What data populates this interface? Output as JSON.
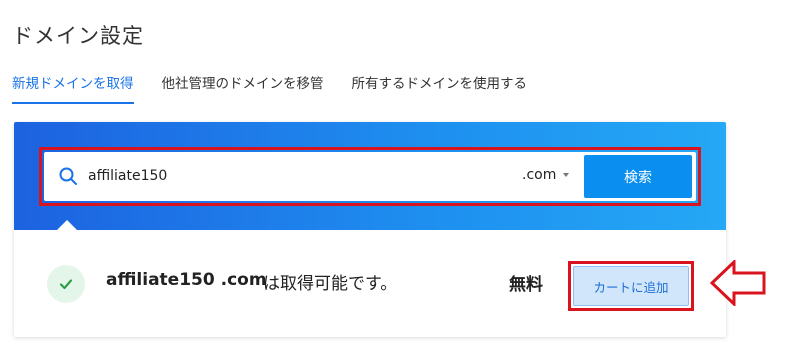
{
  "page": {
    "title": "ドメイン設定"
  },
  "tabs": [
    {
      "label": "新規ドメインを取得",
      "active": true
    },
    {
      "label": "他社管理のドメインを移管",
      "active": false
    },
    {
      "label": "所有するドメインを使用する",
      "active": false
    }
  ],
  "search": {
    "value": "affiliate150",
    "tld": ".com",
    "button_label": "検索",
    "icon": "search-icon"
  },
  "result": {
    "domain": "affiliate150 .com",
    "message": "は取得可能です。",
    "price": "無料",
    "cart_button_label": "カートに追加",
    "status_icon": "check-icon"
  },
  "colors": {
    "accent": "#1a73e8",
    "band_start": "#1d62e0",
    "band_end": "#25a8f5",
    "search_button": "#0a8ff0",
    "highlight": "#d9141e",
    "success": "#2e9e4a"
  }
}
